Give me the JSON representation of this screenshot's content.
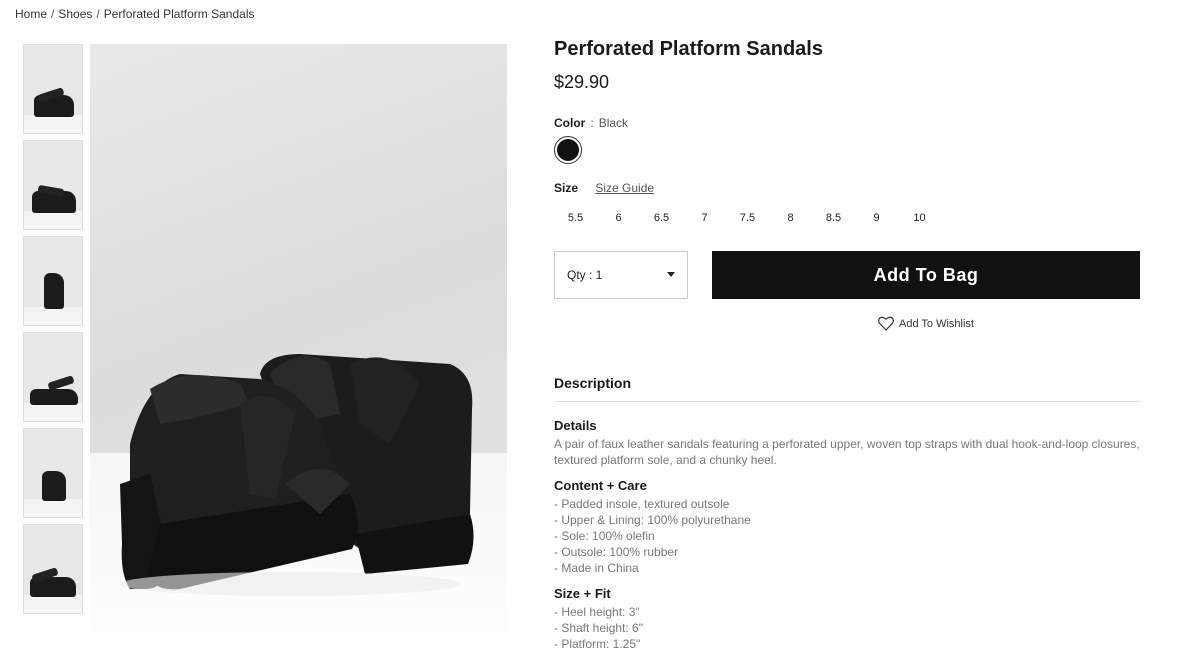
{
  "breadcrumb": [
    "Home",
    "Shoes",
    "Perforated Platform Sandals"
  ],
  "breadcrumb_sep": "/",
  "product": {
    "title": "Perforated Platform Sandals",
    "price": "$29.90",
    "color_label": "Color",
    "color_colon": ":",
    "color_value": "Black",
    "swatch_color": "#111111",
    "size_label": "Size",
    "size_guide": "Size Guide",
    "sizes": [
      "5.5",
      "6",
      "6.5",
      "7",
      "7.5",
      "8",
      "8.5",
      "9",
      "10"
    ],
    "qty": "Qty : 1",
    "add_to_bag": "Add To Bag",
    "wishlist": "Add To Wishlist"
  },
  "description": {
    "heading": "Description",
    "details_h": "Details",
    "details": "A pair of faux leather sandals featuring a perforated upper, woven top straps with dual hook-and-loop closures, textured platform sole, and a chunky heel.",
    "care_h": "Content + Care",
    "care": [
      "- Padded insole, textured outsole",
      "- Upper & Lining: 100% polyurethane",
      "- Sole: 100% olefin",
      "- Outsole: 100% rubber",
      "- Made in China"
    ],
    "fit_h": "Size + Fit",
    "fit": [
      "- Heel height: 3\"",
      "- Shaft height: 6\"",
      "- Platform: 1.25\""
    ]
  },
  "thumbnails": 6,
  "colors": {
    "button": "#111111",
    "text": "#222222",
    "muted": "#777777"
  }
}
